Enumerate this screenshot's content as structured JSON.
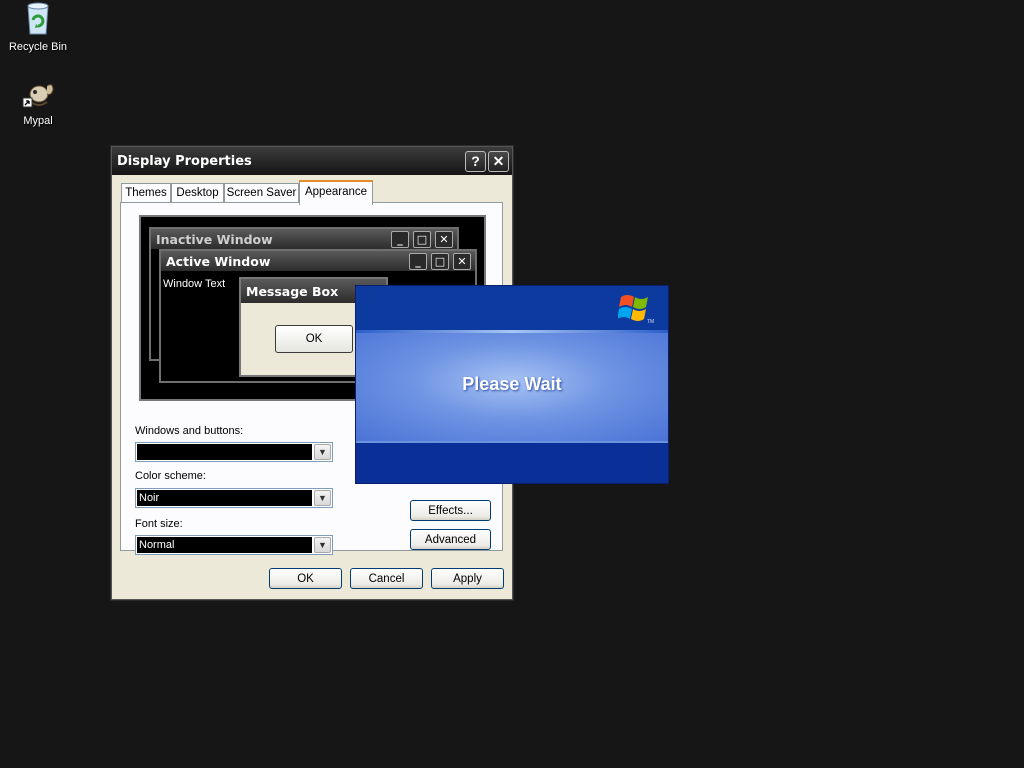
{
  "desktop": {
    "icons": [
      {
        "label": "Recycle Bin"
      },
      {
        "label": "Mypal"
      }
    ]
  },
  "dialog": {
    "title": "Display Properties",
    "help_glyph": "?",
    "close_glyph": "✕",
    "tabs": [
      {
        "label": "Themes"
      },
      {
        "label": "Desktop"
      },
      {
        "label": "Screen Saver"
      },
      {
        "label": "Appearance"
      }
    ],
    "preview": {
      "inactive_title": "Inactive Window",
      "active_title": "Active Window",
      "window_text": "Window Text",
      "message_box_title": "Message Box",
      "ok_label": "OK"
    },
    "windows_and_buttons": {
      "label": "Windows and buttons:",
      "value": ""
    },
    "color_scheme": {
      "label": "Color scheme:",
      "value": "Noir"
    },
    "font_size": {
      "label": "Font size:",
      "value": "Normal"
    },
    "effects_label": "Effects...",
    "advanced_label": "Advanced",
    "ok_label": "OK",
    "cancel_label": "Cancel",
    "apply_label": "Apply"
  },
  "splash": {
    "text": "Please Wait",
    "tm": "TM"
  },
  "colors": {
    "desktop_bg": "#161616",
    "dialog_bg": "#ece9d8",
    "tab_accent": "#e68b2c",
    "splash_blue": "#0b2f94"
  }
}
